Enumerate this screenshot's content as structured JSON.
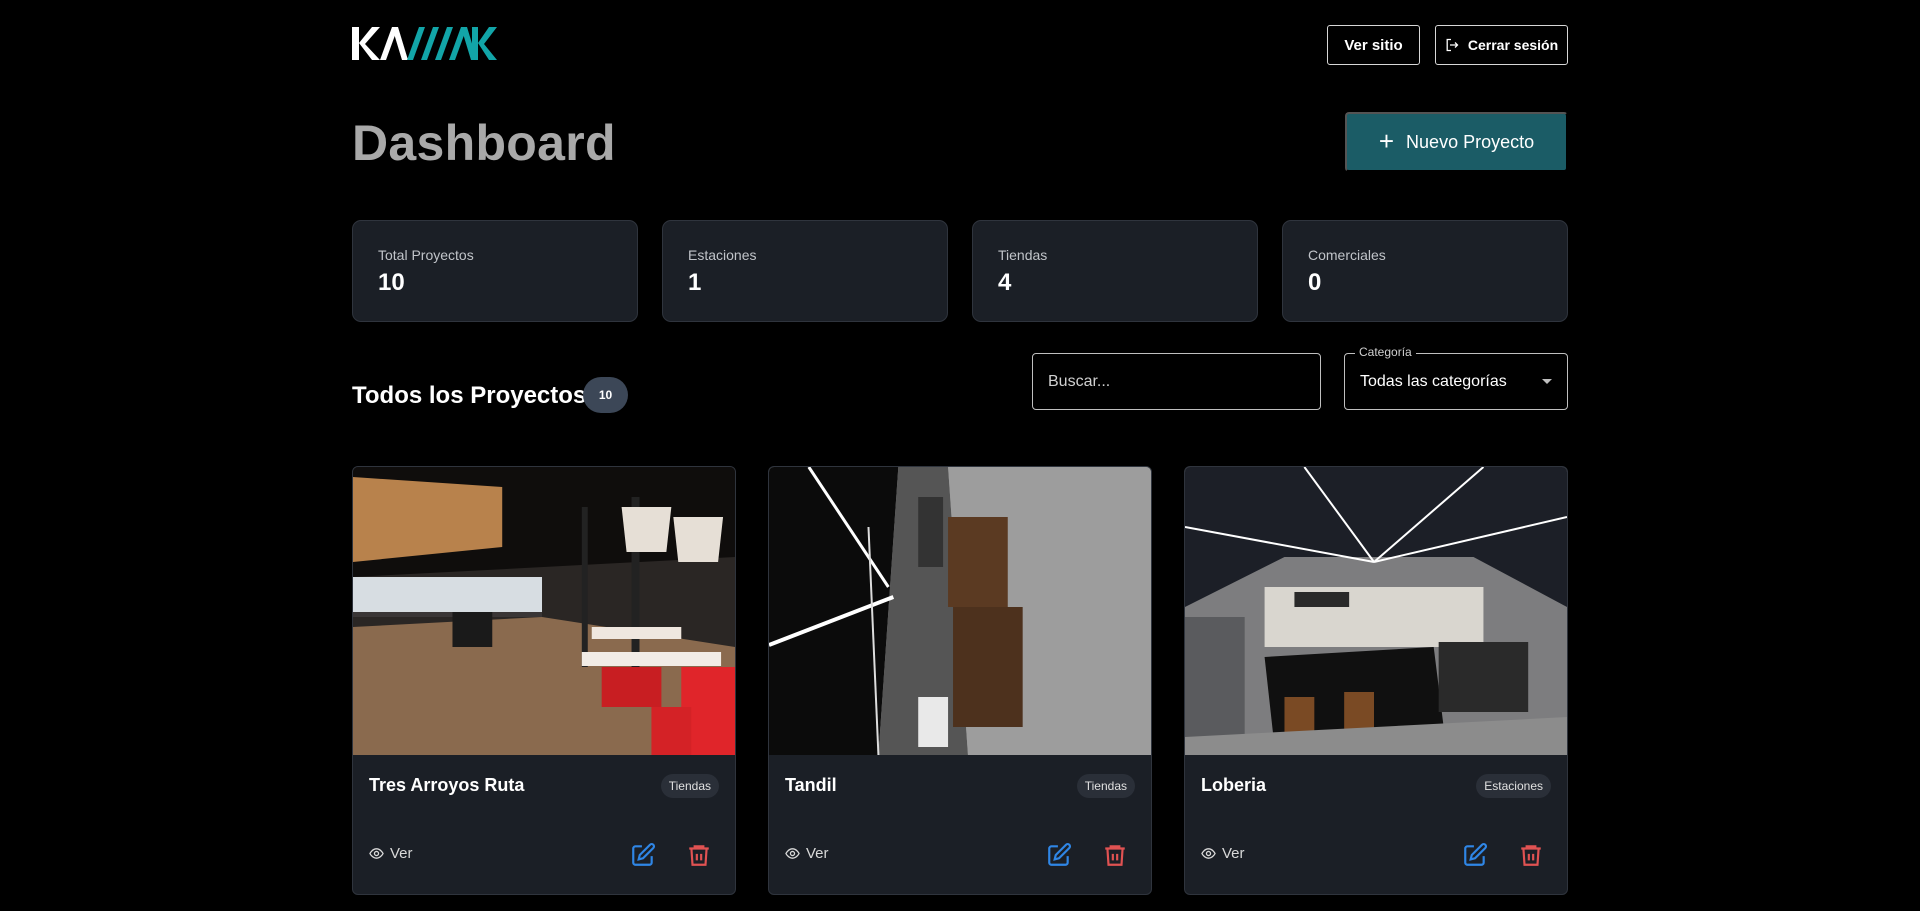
{
  "brand": {
    "logo_text": "KAMAK",
    "accent": "#1b5c66",
    "logo_teal": "#12a5a8"
  },
  "header": {
    "ver_sitio": "Ver sitio",
    "cerrar_sesion": "Cerrar sesión",
    "logout_icon": "logout-icon"
  },
  "page": {
    "title": "Dashboard",
    "new_project": "Nuevo Proyecto",
    "new_project_icon": "plus-icon"
  },
  "stats": [
    {
      "label": "Total Proyectos",
      "value": "10"
    },
    {
      "label": "Estaciones",
      "value": "1"
    },
    {
      "label": "Tiendas",
      "value": "4"
    },
    {
      "label": "Comerciales",
      "value": "0"
    }
  ],
  "section": {
    "title": "Todos los Proyectos",
    "count": "10",
    "search_placeholder": "Buscar...",
    "category_label": "Categoría",
    "category_value": "Todas las categorías"
  },
  "projects": [
    {
      "name": "Tres Arroyos Ruta",
      "category": "Tiendas",
      "view_label": "Ver",
      "image": "restaurant-interior-red-chairs"
    },
    {
      "name": "Tandil",
      "category": "Tiendas",
      "view_label": "Ver",
      "image": "store-interior-rotated"
    },
    {
      "name": "Loberia",
      "category": "Estaciones",
      "view_label": "Ver",
      "image": "cafe-express-counter"
    }
  ],
  "colors": {
    "background": "#000000",
    "card": "#1b1f26",
    "edit_icon": "#2f86e6",
    "delete_icon": "#e05252",
    "title_gray": "#a9a9a9"
  }
}
